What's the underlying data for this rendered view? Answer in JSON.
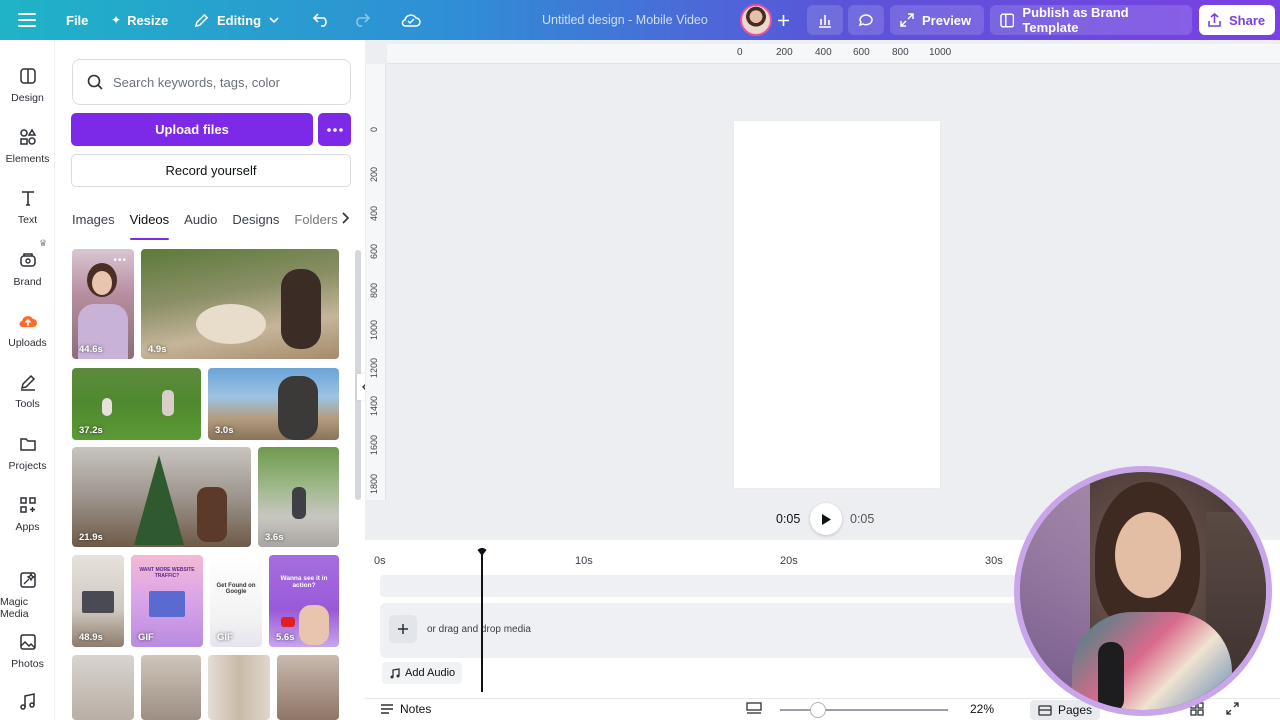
{
  "topbar": {
    "file_label": "File",
    "resize_label": "Resize",
    "editing_label": "Editing",
    "document_title": "Untitled design - Mobile Video",
    "preview_label": "Preview",
    "publish_label": "Publish as Brand Template",
    "share_label": "Share"
  },
  "rail": {
    "items": [
      {
        "label": "Design",
        "icon": "layout-icon"
      },
      {
        "label": "Elements",
        "icon": "shapes-icon"
      },
      {
        "label": "Text",
        "icon": "text-icon"
      },
      {
        "label": "Brand",
        "icon": "brand-icon"
      },
      {
        "label": "Uploads",
        "icon": "cloud-upload-icon"
      },
      {
        "label": "Tools",
        "icon": "pen-icon"
      },
      {
        "label": "Projects",
        "icon": "folder-icon"
      },
      {
        "label": "Apps",
        "icon": "apps-icon"
      },
      {
        "label": "Magic Media",
        "icon": "magic-icon"
      },
      {
        "label": "Photos",
        "icon": "photo-icon"
      }
    ]
  },
  "panel": {
    "search_placeholder": "Search keywords, tags, color",
    "upload_label": "Upload files",
    "record_label": "Record yourself",
    "tabs": [
      "Images",
      "Videos",
      "Audio",
      "Designs",
      "Folders"
    ],
    "active_tab": "Videos",
    "thumbnails": [
      {
        "duration": "44.6s"
      },
      {
        "duration": "4.9s"
      },
      {
        "duration": "37.2s"
      },
      {
        "duration": "3.0s"
      },
      {
        "duration": "21.9s"
      },
      {
        "duration": "3.6s"
      },
      {
        "duration": "48.9s"
      },
      {
        "duration": "GIF",
        "text": "WANT MORE WEBSITE TRAFFIC?"
      },
      {
        "duration": "GIF",
        "text": "Get Found on Google"
      },
      {
        "duration": "5.6s",
        "text": "Wanna see it in action?"
      }
    ]
  },
  "rulers": {
    "x": [
      "0",
      "200",
      "400",
      "600",
      "800",
      "1000"
    ],
    "y": [
      "0",
      "200",
      "400",
      "600",
      "800",
      "1000",
      "1200",
      "1400",
      "1600",
      "1800"
    ]
  },
  "playback": {
    "current_time": "0:05",
    "total_time": "0:05"
  },
  "timeline": {
    "ticks": [
      "0s",
      "10s",
      "20s",
      "30s"
    ],
    "drop_text": "or drag and drop media",
    "add_audio_label": "Add Audio"
  },
  "bottombar": {
    "notes_label": "Notes",
    "zoom_value": "22%",
    "zoom_fraction": 0.22,
    "pages_label": "Pages"
  },
  "colors": {
    "accent": "#7d2ae8",
    "topbar_start": "#1fb3c6",
    "topbar_end": "#7b3fe4",
    "uploads_icon": "#ff6b2c"
  }
}
